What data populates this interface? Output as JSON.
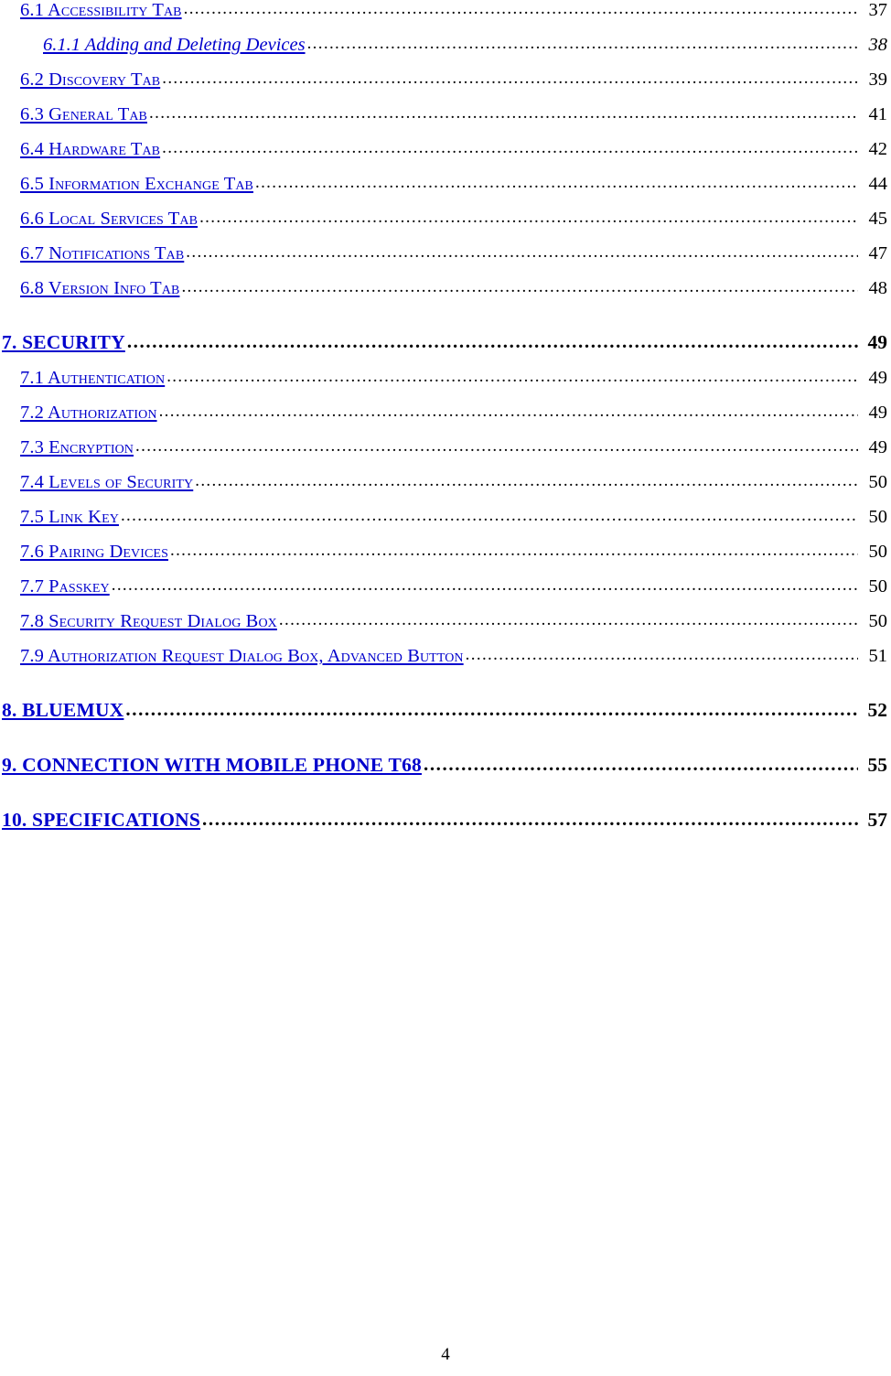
{
  "document": {
    "footer_page_number": "4",
    "link_color": "#0000CC",
    "text_color": "#000000",
    "leader_char": "."
  },
  "toc": {
    "entries": [
      {
        "level": 2,
        "title": "6.1 Accessibility Tab",
        "page": "37"
      },
      {
        "level": 3,
        "title": "6.1.1 Adding and Deleting Devices",
        "page": "38"
      },
      {
        "level": 2,
        "title": "6.2 Discovery Tab",
        "page": "39"
      },
      {
        "level": 2,
        "title": "6.3 General Tab",
        "page": "41"
      },
      {
        "level": 2,
        "title": "6.4 Hardware Tab",
        "page": "42"
      },
      {
        "level": 2,
        "title": "6.5 Information Exchange Tab",
        "page": "44"
      },
      {
        "level": 2,
        "title": "6.6 Local Services Tab",
        "page": "45"
      },
      {
        "level": 2,
        "title": "6.7 Notifications Tab",
        "page": "47"
      },
      {
        "level": 2,
        "title": "6.8 Version Info Tab",
        "page": "48"
      },
      {
        "level": 1,
        "title": "7. SECURITY",
        "page": "49"
      },
      {
        "level": 2,
        "title": "7.1 Authentication",
        "page": "49"
      },
      {
        "level": 2,
        "title": "7.2 Authorization",
        "page": "49"
      },
      {
        "level": 2,
        "title": "7.3 Encryption",
        "page": "49"
      },
      {
        "level": 2,
        "title": "7.4 Levels of Security",
        "page": "50"
      },
      {
        "level": 2,
        "title": "7.5 Link Key",
        "page": "50"
      },
      {
        "level": 2,
        "title": "7.6 Pairing Devices",
        "page": "50"
      },
      {
        "level": 2,
        "title": "7.7 Passkey",
        "page": "50"
      },
      {
        "level": 2,
        "title": "7.8 Security Request Dialog Box",
        "page": "50"
      },
      {
        "level": 2,
        "title": "7.9 Authorization Request Dialog Box, Advanced Button",
        "page": "51"
      },
      {
        "level": 1,
        "title": "8. BLUEMUX",
        "page": "52"
      },
      {
        "level": 1,
        "title": "9. CONNECTION WITH MOBILE PHONE T68",
        "page": "55"
      },
      {
        "level": 1,
        "title": "10. SPECIFICATIONS",
        "page": "57"
      }
    ]
  }
}
